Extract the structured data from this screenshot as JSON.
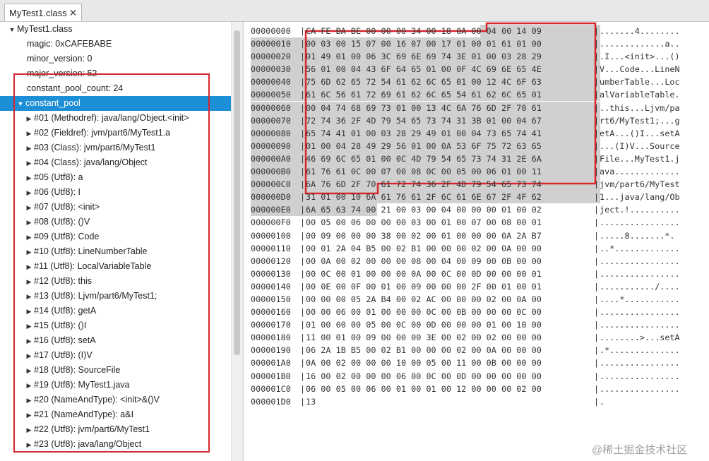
{
  "tab": {
    "label": "MyTest1.class",
    "close": "✕"
  },
  "tree": {
    "root": "MyTest1.class",
    "fields": [
      "magic: 0xCAFEBABE",
      "minor_version: 0",
      "major_version: 52",
      "constant_pool_count: 24"
    ],
    "constant_pool": "constant_pool",
    "entries": [
      "#01 (Methodref): java/lang/Object.<init>",
      "#02 (Fieldref): jvm/part6/MyTest1.a",
      "#03 (Class): jvm/part6/MyTest1",
      "#04 (Class): java/lang/Object",
      "#05 (Utf8): a",
      "#06 (Utf8): I",
      "#07 (Utf8): <init>",
      "#08 (Utf8): ()V",
      "#09 (Utf8): Code",
      "#10 (Utf8): LineNumberTable",
      "#11 (Utf8): LocalVariableTable",
      "#12 (Utf8): this",
      "#13 (Utf8): Ljvm/part6/MyTest1;",
      "#14 (Utf8): getA",
      "#15 (Utf8): ()I",
      "#16 (Utf8): setA",
      "#17 (Utf8): (I)V",
      "#18 (Utf8): SourceFile",
      "#19 (Utf8): MyTest1.java",
      "#20 (NameAndType): <init>&()V",
      "#21 (NameAndType): a&I",
      "#22 (Utf8): jvm/part6/MyTest1",
      "#23 (Utf8): java/lang/Object"
    ]
  },
  "hex": [
    {
      "offset": "00000000",
      "bytes": "CA FE BA BE 00 00 00 34 00 18 0A 00 04 00 14 09",
      "ascii": ".......4........"
    },
    {
      "offset": "00000010",
      "bytes": "00 03 00 15 07 00 16 07 00 17 01 00 01 61 01 00",
      "ascii": ".............a.."
    },
    {
      "offset": "00000020",
      "bytes": "01 49 01 00 06 3C 69 6E 69 74 3E 01 00 03 28 29",
      "ascii": ".I...<init>...()"
    },
    {
      "offset": "00000030",
      "bytes": "56 01 00 04 43 6F 64 65 01 00 0F 4C 69 6E 65 4E",
      "ascii": "V...Code...LineN"
    },
    {
      "offset": "00000040",
      "bytes": "75 6D 62 65 72 54 61 62 6C 65 01 00 12 4C 6F 63",
      "ascii": "umberTable...Loc"
    },
    {
      "offset": "00000050",
      "bytes": "61 6C 56 61 72 69 61 62 6C 65 54 61 62 6C 65 01",
      "ascii": "alVariableTable."
    },
    {
      "offset": "00000060",
      "bytes": "00 04 74 68 69 73 01 00 13 4C 6A 76 6D 2F 70 61",
      "ascii": "..this...Ljvm/pa"
    },
    {
      "offset": "00000070",
      "bytes": "72 74 36 2F 4D 79 54 65 73 74 31 3B 01 00 04 67",
      "ascii": "rt6/MyTest1;...g"
    },
    {
      "offset": "00000080",
      "bytes": "65 74 41 01 00 03 28 29 49 01 00 04 73 65 74 41",
      "ascii": "etA...()I...setA"
    },
    {
      "offset": "00000090",
      "bytes": "01 00 04 28 49 29 56 01 00 0A 53 6F 75 72 63 65",
      "ascii": "...(I)V...Source"
    },
    {
      "offset": "000000A0",
      "bytes": "46 69 6C 65 01 00 0C 4D 79 54 65 73 74 31 2E 6A",
      "ascii": "File...MyTest1.j"
    },
    {
      "offset": "000000B0",
      "bytes": "61 76 61 0C 00 07 00 08 0C 00 05 00 06 01 00 11",
      "ascii": "ava............."
    },
    {
      "offset": "000000C0",
      "bytes": "6A 76 6D 2F 70 61 72 74 36 2F 4D 79 54 65 73 74",
      "ascii": "jvm/part6/MyTest"
    },
    {
      "offset": "000000D0",
      "bytes": "31 01 00 10 6A 61 76 61 2F 6C 61 6E 67 2F 4F 62",
      "ascii": "1...java/lang/Ob"
    },
    {
      "offset": "000000E0",
      "bytes": "6A 65 63 74 00 21 00 03 00 04 00 00 00 01 00 02",
      "ascii": "ject.!.........."
    },
    {
      "offset": "000000F0",
      "bytes": "00 05 00 06 00 00 00 03 00 01 00 07 00 08 00 01",
      "ascii": "................"
    },
    {
      "offset": "00000100",
      "bytes": "00 09 00 00 00 38 00 02 00 01 00 00 00 0A 2A B7",
      "ascii": ".....8.......*."
    },
    {
      "offset": "00000110",
      "bytes": "00 01 2A 04 B5 00 02 B1 00 00 00 02 00 0A 00 00",
      "ascii": "..*............."
    },
    {
      "offset": "00000120",
      "bytes": "00 0A 00 02 00 00 00 08 00 04 00 09 00 0B 00 00",
      "ascii": "................"
    },
    {
      "offset": "00000130",
      "bytes": "00 0C 00 01 00 00 00 0A 00 0C 00 0D 00 00 00 01",
      "ascii": "................"
    },
    {
      "offset": "00000140",
      "bytes": "00 0E 00 0F 00 01 00 09 00 00 00 2F 00 01 00 01",
      "ascii": ".........../...."
    },
    {
      "offset": "00000150",
      "bytes": "00 00 00 05 2A B4 00 02 AC 00 00 00 02 00 0A 00",
      "ascii": "....*..........."
    },
    {
      "offset": "00000160",
      "bytes": "00 00 06 00 01 00 00 00 0C 00 0B 00 00 00 0C 00",
      "ascii": "................"
    },
    {
      "offset": "00000170",
      "bytes": "01 00 00 00 05 00 0C 00 0D 00 00 00 01 00 10 00",
      "ascii": "................"
    },
    {
      "offset": "00000180",
      "bytes": "11 00 01 00 09 00 00 00 3E 00 02 00 02 00 00 00",
      "ascii": "........>...setA"
    },
    {
      "offset": "00000190",
      "bytes": "06 2A 1B B5 00 02 B1 00 00 00 02 00 0A 00 00 00",
      "ascii": ".*.............."
    },
    {
      "offset": "000001A0",
      "bytes": "0A 00 02 00 00 00 10 00 05 00 11 00 0B 00 00 00",
      "ascii": "................"
    },
    {
      "offset": "000001B0",
      "bytes": "16 00 02 00 00 00 06 00 0C 00 0D 00 00 00 00 00",
      "ascii": "................"
    },
    {
      "offset": "000001C0",
      "bytes": "06 00 05 00 06 00 01 00 01 00 12 00 00 00 02 00",
      "ascii": "................"
    },
    {
      "offset": "000001D0",
      "bytes": "13",
      "ascii": "."
    }
  ],
  "watermark": "@稀土掘金技术社区",
  "colors": {
    "selection": "#1d8fd6",
    "highlight": "#d0d0d0",
    "annotation": "#d8262c"
  }
}
